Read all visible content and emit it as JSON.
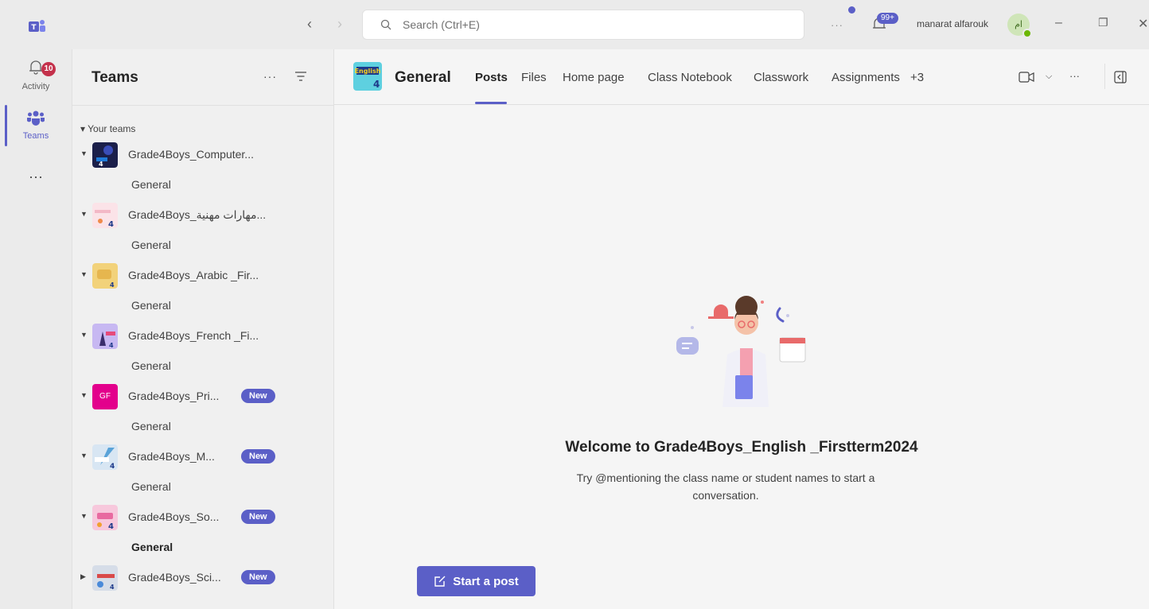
{
  "titlebar": {
    "search_placeholder": "Search (Ctrl+E)",
    "more_label": "···",
    "activity_badge": "99+",
    "user_name": "manarat alfarouk",
    "avatar_initials": "ام"
  },
  "rail": {
    "activity_label": "Activity",
    "activity_badge": "10",
    "teams_label": "Teams",
    "more_label": "···"
  },
  "panel": {
    "title": "Teams",
    "more_label": "···",
    "section_label": "Your teams",
    "teams": [
      {
        "name": "Grade4Boys_Computer...",
        "channel": "General",
        "new": ""
      },
      {
        "name": "Grade4Boys_مهارات مهنية...",
        "channel": "General",
        "new": ""
      },
      {
        "name": "Grade4Boys_Arabic _Fir...",
        "channel": "General",
        "new": ""
      },
      {
        "name": "Grade4Boys_French _Fi...",
        "channel": "General",
        "new": ""
      },
      {
        "name": "Grade4Boys_Pri...",
        "channel": "General",
        "new": "New",
        "icon_text": "GF"
      },
      {
        "name": "Grade4Boys_M...",
        "channel": "General",
        "new": "New"
      },
      {
        "name": "Grade4Boys_So...",
        "channel": "General",
        "new": "New"
      },
      {
        "name": "Grade4Boys_Sci...",
        "channel": "",
        "new": "New"
      }
    ]
  },
  "main": {
    "channel_title": "General",
    "tabs": [
      "Posts",
      "Files",
      "Home page",
      "Class Notebook",
      "Classwork",
      "Assignments",
      "+3"
    ],
    "welcome": "Welcome to Grade4Boys_English _Firstterm2024",
    "hint": "Try @mentioning the class name or student names to start a conversation.",
    "start_post": "Start a post",
    "more_label": "···"
  },
  "colors": {
    "accent": "#5b5fc7",
    "badge_red": "#c4314b",
    "presence_green": "#6bb700"
  }
}
